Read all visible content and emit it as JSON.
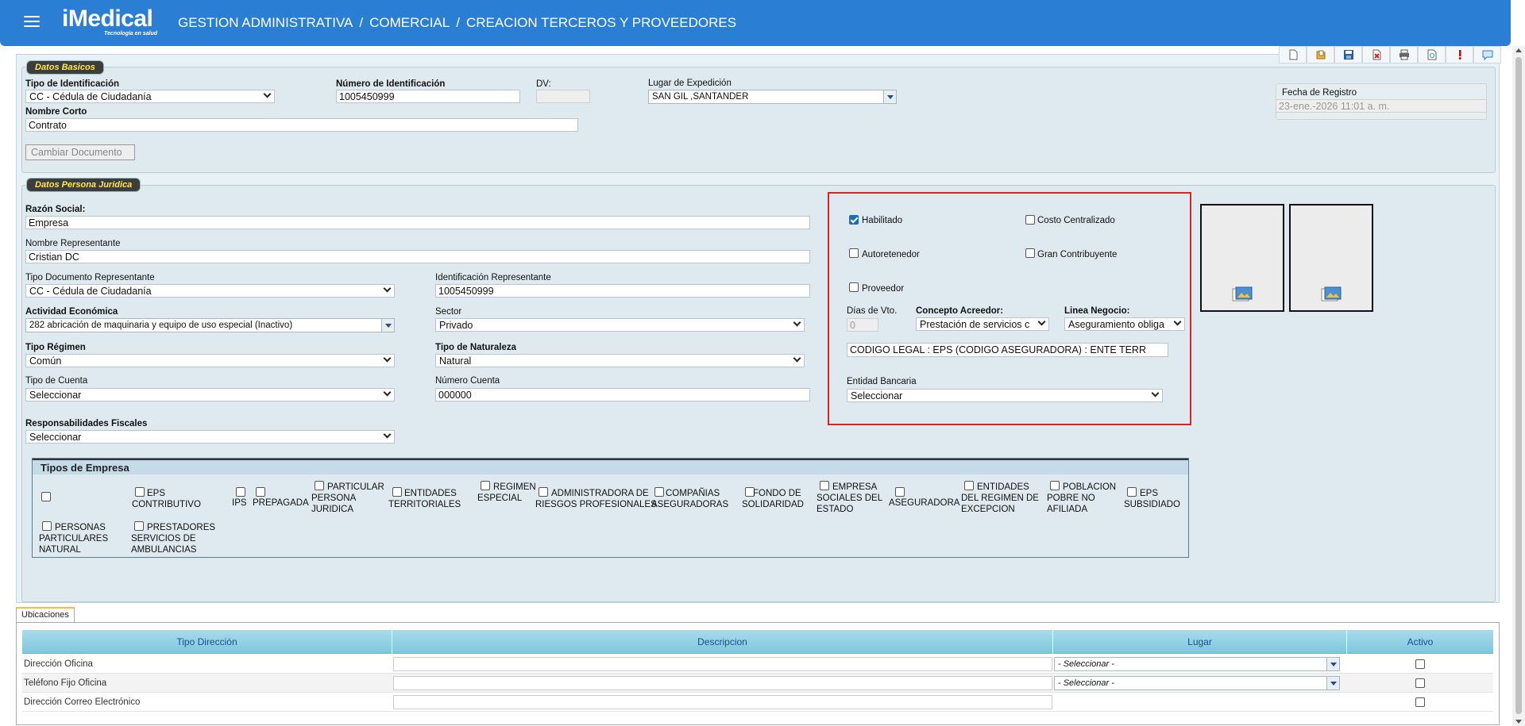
{
  "header": {
    "logo_text": "iMedical",
    "logo_tagline": "Tecnología en salud",
    "breadcrumb": [
      "GESTION ADMINISTRATIVA",
      "COMERCIAL",
      "CREACION TERCEROS Y PROVEEDORES"
    ],
    "separator": "/"
  },
  "toolbar": {
    "icons": [
      "new-document-icon",
      "open-folder-icon",
      "save-icon",
      "delete-icon",
      "print-icon",
      "preview-icon",
      "alert-icon",
      "comment-icon"
    ]
  },
  "datos_basicos": {
    "legend": "Datos Basicos",
    "tipo_id_label": "Tipo de Identificación",
    "tipo_id_value": "CC - Cédula de Ciudadanía",
    "num_id_label": "Número de Identificación",
    "num_id_value": "1005450999",
    "dv_label": "DV:",
    "dv_value": "",
    "lugar_label": "Lugar de Expedición",
    "lugar_value": "SAN GIL ,SANTANDER",
    "nombre_corto_label": "Nombre Corto",
    "nombre_corto_value": "Contrato",
    "cambiar_btn": "Cambiar Documento",
    "fecha_label": "Fecha de Registro",
    "fecha_value": "23-ene.-2026 11:01 a. m."
  },
  "persona_juridica": {
    "legend": "Datos Persona Juridica",
    "razon_label": "Razón Social:",
    "razon_value": "Empresa",
    "rep_label": "Nombre Representante",
    "rep_value": "Cristian DC",
    "tipo_doc_rep_label": "Tipo Documento Representante",
    "tipo_doc_rep_value": "CC - Cédula de Ciudadanía",
    "id_rep_label": "Identificación Representante",
    "id_rep_value": "1005450999",
    "actividad_label": "Actividad Económica",
    "actividad_value": "282  abricación de maquinaria y equipo de uso especial (Inactivo)",
    "sector_label": "Sector",
    "sector_value": "Privado",
    "regimen_label": "Tipo Régimen",
    "regimen_value": "Común",
    "naturaleza_label": "Tipo de Naturaleza",
    "naturaleza_value": "Natural",
    "tipo_cuenta_label": "Tipo de Cuenta",
    "tipo_cuenta_value": "Seleccionar",
    "num_cuenta_label": "Número Cuenta",
    "num_cuenta_value": "000000",
    "resp_fiscales_label": "Responsabilidades Fiscales",
    "resp_fiscales_value": "Seleccionar"
  },
  "config": {
    "habilitado": {
      "label": "Habilitado",
      "checked": true
    },
    "costo_centralizado": {
      "label": "Costo Centralizado",
      "checked": false
    },
    "autoretenedor": {
      "label": "Autoretenedor",
      "checked": false
    },
    "gran_contribuyente": {
      "label": "Gran Contribuyente",
      "checked": false
    },
    "proveedor": {
      "label": "Proveedor",
      "checked": false
    },
    "dias_vto_label": "Días de Vto.",
    "dias_vto_value": "0",
    "concepto_label": "Concepto Acreedor:",
    "concepto_value": "Prestación de servicios c",
    "linea_label": "Linea Negocio:",
    "linea_value": "Aseguramiento obliga",
    "codigo_legal": "CODIGO LEGAL : EPS (CODIGO ASEGURADORA) : ENTE TERR",
    "entidad_label": "Entidad Bancaria",
    "entidad_value": "Seleccionar"
  },
  "tipos_empresa": {
    "title": "Tipos de Empresa",
    "items": [
      {
        "label": "",
        "checked": false
      },
      {
        "label": "EPS\nCONTRIBUTIVO",
        "checked": false
      },
      {
        "label": "IPS",
        "checked": false
      },
      {
        "label": "PREPAGADA",
        "checked": false
      },
      {
        "label": "PARTICULAR\nPERSONA\nJURIDICA",
        "checked": false
      },
      {
        "label": "ENTIDADES\nTERRITORIALES",
        "checked": false
      },
      {
        "label": "REGIMEN\nESPECIAL",
        "checked": false
      },
      {
        "label": "ADMINISTRADORA DE\nRIESGOS PROFESIONALES",
        "checked": false
      },
      {
        "label": "COMPAÑIAS\nASEGURADORAS",
        "checked": false
      },
      {
        "label": "FONDO DE\nSOLIDARIDAD",
        "checked": false
      },
      {
        "label": "EMPRESA\nSOCIALES DEL\nESTADO",
        "checked": false
      },
      {
        "label": "ASEGURADORA",
        "checked": false
      },
      {
        "label": "ENTIDADES\nDEL REGIMEN DE\nEXCEPCION",
        "checked": false
      },
      {
        "label": "POBLACION\nPOBRE NO\nAFILIADA",
        "checked": false
      },
      {
        "label": "EPS\nSUBSIDIADO",
        "checked": false
      },
      {
        "label": "PERSONAS\nPARTICULARES\nNATURAL",
        "checked": false
      },
      {
        "label": "PRESTADORES\nSERVICIOS DE\nAMBULANCIAS",
        "checked": false
      }
    ]
  },
  "ubicaciones": {
    "tab_label": "Ubicaciones",
    "columns": [
      "Tipo Dirección",
      "Descripcion",
      "Lugar",
      "Activo"
    ],
    "rows": [
      {
        "tipo": "Dirección Oficina",
        "descripcion": "",
        "lugar": "- Seleccionar -",
        "has_lugar": true,
        "activo": false
      },
      {
        "tipo": "Teléfono Fijo Oficina",
        "descripcion": "",
        "lugar": "- Seleccionar -",
        "has_lugar": true,
        "activo": false
      },
      {
        "tipo": "Dirección Correo Electrónico",
        "descripcion": "",
        "lugar": "",
        "has_lugar": false,
        "activo": false
      }
    ]
  }
}
